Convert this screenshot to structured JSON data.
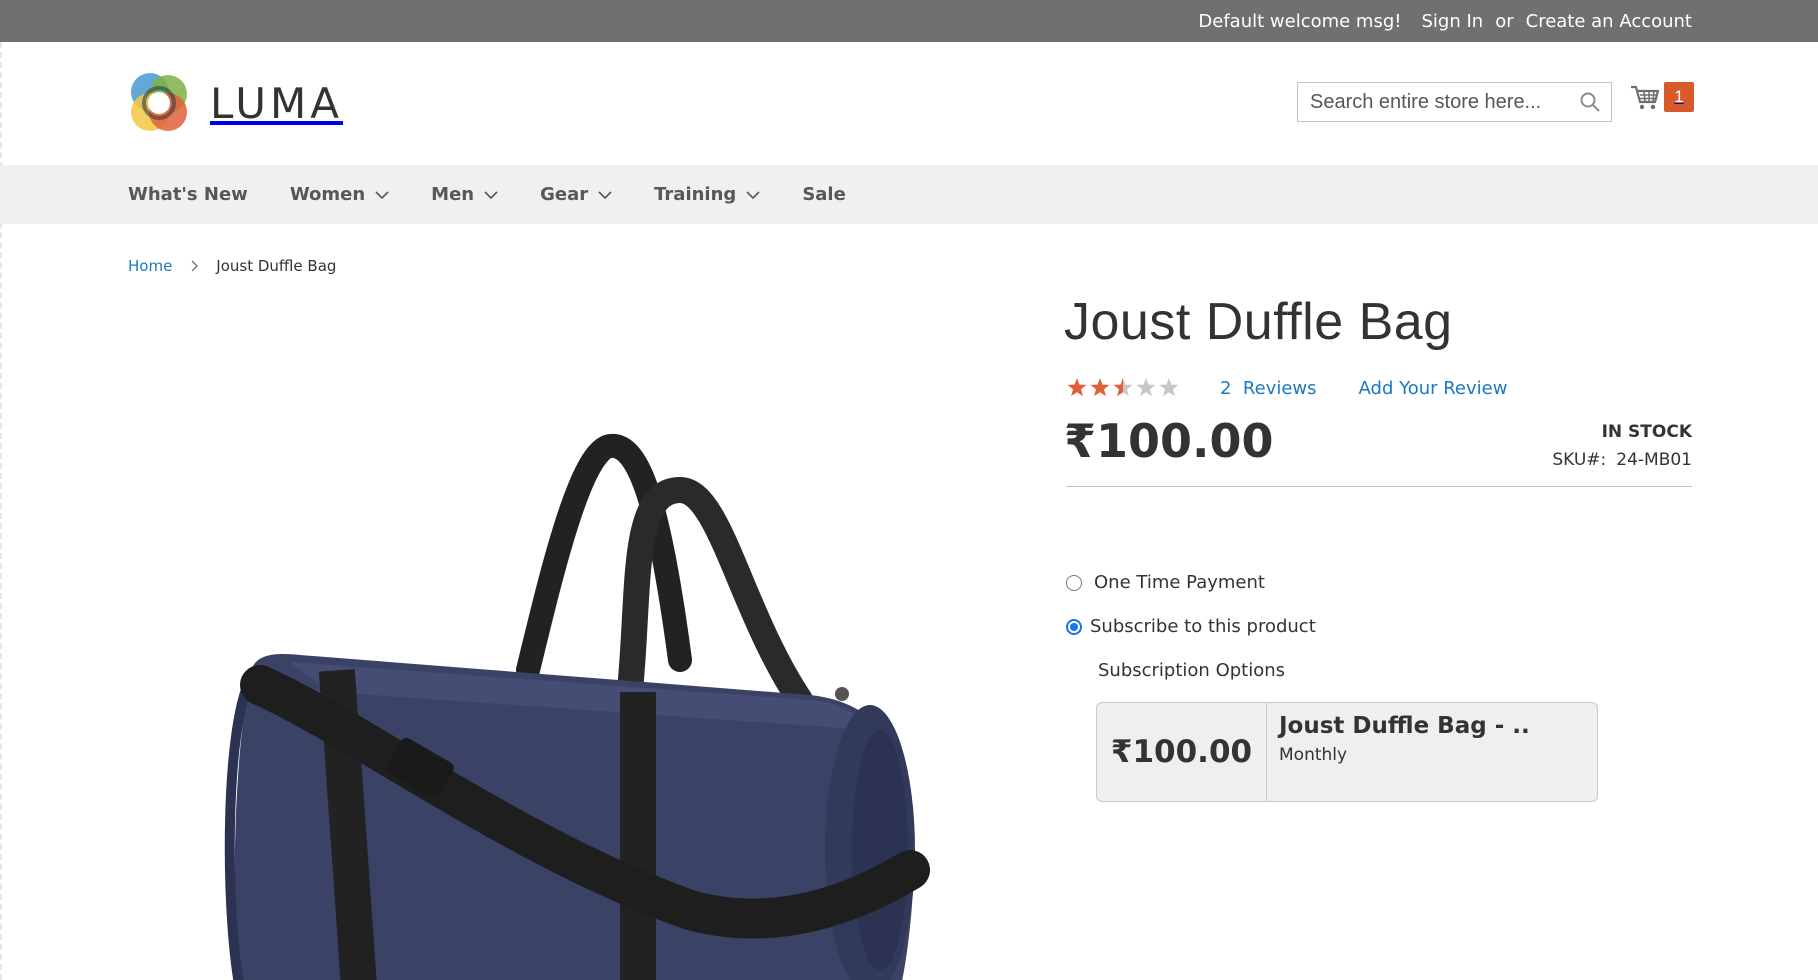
{
  "top_panel": {
    "welcome": "Default welcome msg!",
    "sign_in": "Sign In",
    "or": "or",
    "create_account": "Create an Account"
  },
  "header": {
    "logo_text": "LUMA",
    "search_placeholder": "Search entire store here...",
    "cart_count": "1"
  },
  "nav": {
    "items": [
      {
        "label": "What's New",
        "has_dropdown": false
      },
      {
        "label": "Women",
        "has_dropdown": true
      },
      {
        "label": "Men",
        "has_dropdown": true
      },
      {
        "label": "Gear",
        "has_dropdown": true
      },
      {
        "label": "Training",
        "has_dropdown": true
      },
      {
        "label": "Sale",
        "has_dropdown": false
      }
    ]
  },
  "breadcrumb": {
    "home": "Home",
    "current": "Joust Duffle Bag"
  },
  "product": {
    "title": "Joust Duffle Bag",
    "rating": 2.5,
    "rating_max": 5,
    "reviews_count": "2",
    "reviews_label": "Reviews",
    "add_review": "Add Your Review",
    "price": "₹100.00",
    "stock": "In stock",
    "sku_label": "SKU#:",
    "sku": "24-MB01"
  },
  "purchase_options": {
    "one_time": "One Time Payment",
    "subscribe": "Subscribe to this product",
    "selected": "subscribe",
    "subscription_options_title": "Subscription Options",
    "subscription": {
      "price": "₹100.00",
      "name": "Joust Duffle Bag - ..",
      "frequency": "Monthly"
    }
  },
  "colors": {
    "top_panel": "#6e716e",
    "link": "#1979c3",
    "star": "#e0603a",
    "cart_badge": "#d85a2a",
    "radio_checked": "#1a73e8",
    "bag": "#3a4266"
  }
}
